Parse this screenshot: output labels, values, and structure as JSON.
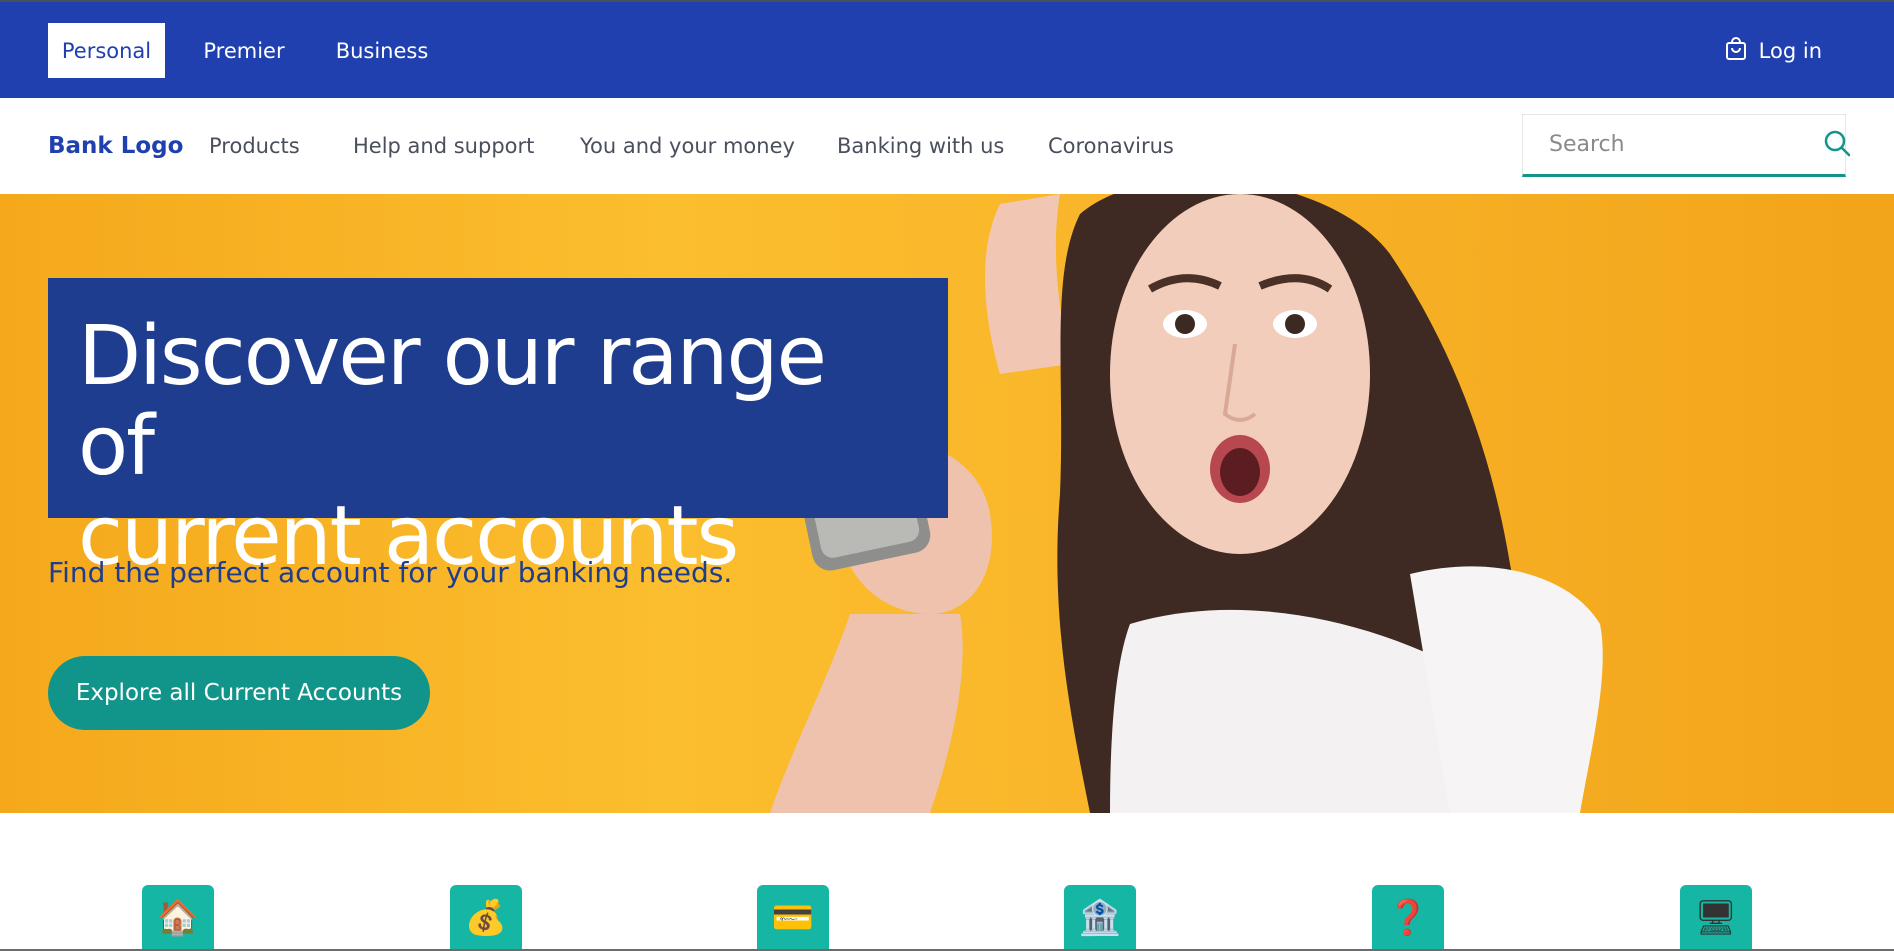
{
  "topbar": {
    "tabs": [
      {
        "label": "Personal",
        "active": true
      },
      {
        "label": "Premier",
        "active": false
      },
      {
        "label": "Business",
        "active": false
      }
    ],
    "login_label": "Log in",
    "login_icon": "shopping-bag-icon"
  },
  "navbar": {
    "brand": "Bank Logo",
    "items": [
      {
        "label": "Products"
      },
      {
        "label": "Help and support"
      },
      {
        "label": "You and your money"
      },
      {
        "label": "Banking with us"
      },
      {
        "label": "Coronavirus"
      }
    ],
    "search": {
      "placeholder": "Search",
      "value": "",
      "icon": "search-icon"
    }
  },
  "hero": {
    "headline_line1": "Discover our range of",
    "headline_line2": "current accounts",
    "subhead": "Find the perfect account for your banking needs.",
    "cta_label": "Explore all Current Accounts",
    "image": "surprised-woman-holding-phone"
  },
  "tiles": [
    {
      "icon": "house-icon",
      "glyph": "🏠"
    },
    {
      "icon": "money-bag-icon",
      "glyph": "💰"
    },
    {
      "icon": "credit-card-icon",
      "glyph": "💳"
    },
    {
      "icon": "bank-icon",
      "glyph": "🏦"
    },
    {
      "icon": "question-mark-icon",
      "glyph": "❓"
    },
    {
      "icon": "computer-icon",
      "glyph": "🖥"
    }
  ],
  "colors": {
    "primary_blue": "#1f40ae",
    "headline_blue": "#1f3d8e",
    "teal": "#11948a",
    "tile_teal": "#16b6a4",
    "hero_yellow": "#fbbe2e"
  }
}
